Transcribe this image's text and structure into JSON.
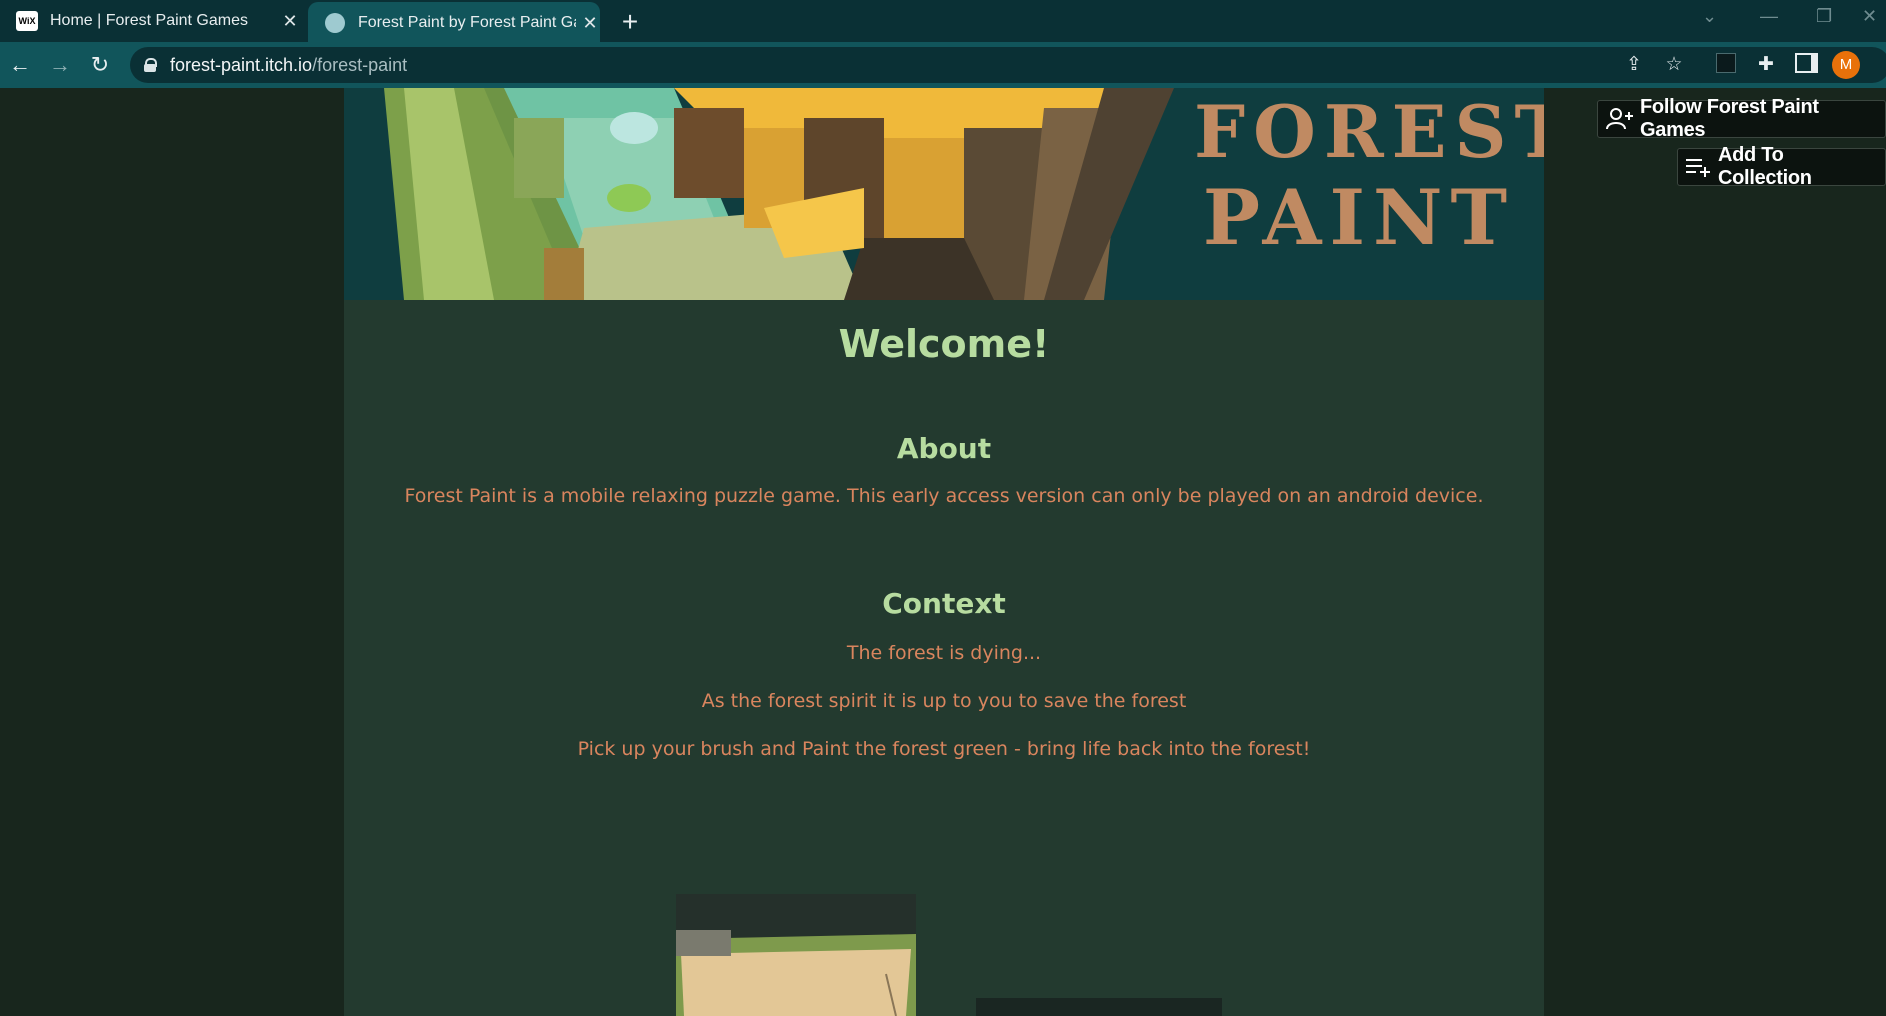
{
  "browser": {
    "tabs": [
      {
        "title": "Home | Forest Paint Games",
        "favicon": "wix-icon"
      },
      {
        "title": "Forest Paint by Forest Paint Games",
        "favicon": "forest-paint-icon"
      }
    ],
    "url_host": "forest-paint.itch.io",
    "url_path": "/forest-paint",
    "avatar_letter": "M"
  },
  "banner": {
    "logo_line1": "FOREST",
    "logo_line2": "PAINT"
  },
  "page": {
    "welcome": "Welcome!",
    "about_heading": "About",
    "about_text": "Forest Paint is a mobile relaxing puzzle game. This early access version can only be played on an android device.",
    "context_heading": "Context",
    "context_lines": [
      "The forest is dying...",
      "As the forest spirit it is up to you to save the forest",
      "Pick up your brush and Paint the forest green - bring life back into the forest!"
    ]
  },
  "actions": {
    "follow_label": "Follow Forest Paint Games",
    "collection_label": "Add To Collection"
  },
  "colors": {
    "heading": "#b7dca0",
    "body_text": "#d9855e",
    "page_bg": "#233a2f",
    "outer_bg": "#18261d"
  }
}
